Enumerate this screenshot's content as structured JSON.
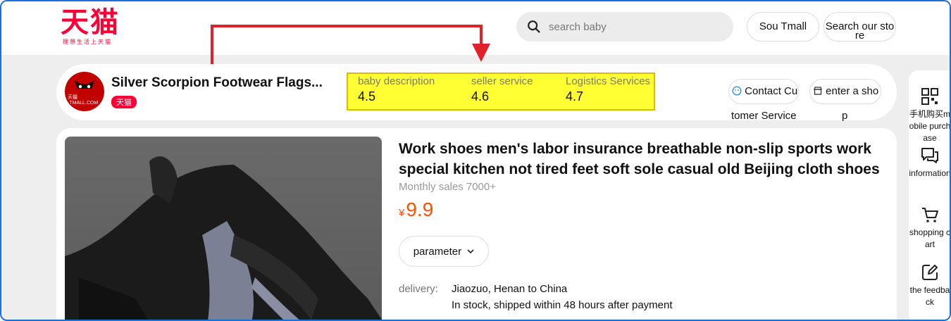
{
  "brand": {
    "logo_text": "天猫",
    "tagline": "理想生活上天猫"
  },
  "search": {
    "placeholder": "search baby"
  },
  "header_buttons": {
    "sou_tmall": "Sou Tmall",
    "search_store": "Search our sto re"
  },
  "shop": {
    "logo_text": "天猫·TMALL.COM",
    "name": "Silver Scorpion Footwear Flags...",
    "badge": "天猫",
    "ratings": [
      {
        "label": "baby description",
        "value": "4.5"
      },
      {
        "label": "seller service",
        "value": "4.6"
      },
      {
        "label": "Logistics Services",
        "value": "4.7"
      }
    ],
    "contact_button": "Contact Cus",
    "contact_tail": "tomer Service",
    "enter_button": "enter a sho",
    "enter_tail": "p"
  },
  "product": {
    "title": "Work shoes men's labor insurance breathable non-slip sports work special kitchen not tired feet soft sole casual old Beijing cloth shoes",
    "monthly_sales": "Monthly sales 7000+",
    "currency": "¥",
    "price": "9.9",
    "parameter_button": "parameter",
    "delivery_label": "delivery:",
    "delivery_route": "Jiaozuo, Henan to China",
    "delivery_stock": "In stock, shipped within 48 hours after payment"
  },
  "sidebar": {
    "items": [
      {
        "icon": "qr-code-icon",
        "label": "手机购买mobile purchase"
      },
      {
        "icon": "chat-icon",
        "label": "information"
      },
      {
        "icon": "cart-icon",
        "label": "shopping cart"
      },
      {
        "icon": "edit-icon",
        "label": "the feedback"
      }
    ]
  },
  "colors": {
    "brand": "#ff0036",
    "price": "#ff5000",
    "highlight": "#ffff33",
    "annotation": "#e0202a"
  }
}
